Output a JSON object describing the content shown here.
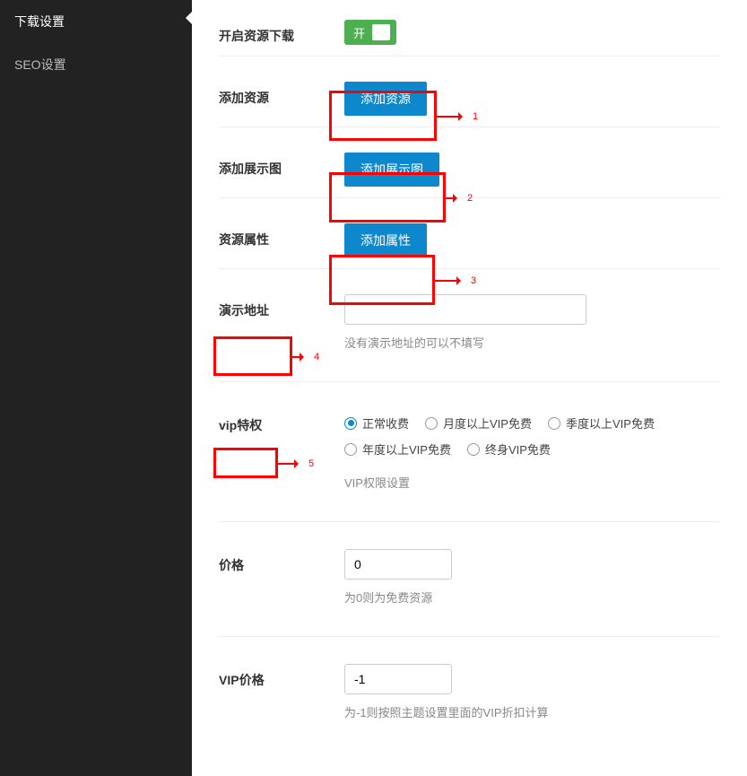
{
  "sidebar": {
    "items": [
      {
        "label": "下载设置",
        "active": true
      },
      {
        "label": "SEO设置",
        "active": false
      }
    ]
  },
  "settings": {
    "enable_download": {
      "label": "开启资源下载",
      "toggle_text": "开"
    },
    "add_resource": {
      "label": "添加资源",
      "button": "添加资源"
    },
    "add_showcase": {
      "label": "添加展示图",
      "button": "添加展示图"
    },
    "resource_attr": {
      "label": "资源属性",
      "button": "添加属性"
    },
    "demo_url": {
      "label": "演示地址",
      "value": "",
      "help": "没有演示地址的可以不填写"
    },
    "vip": {
      "label": "vip特权",
      "options": [
        "正常收费",
        "月度以上VIP免费",
        "季度以上VIP免费",
        "年度以上VIP免费",
        "终身VIP免费"
      ],
      "selected_index": 0,
      "help": "VIP权限设置"
    },
    "price": {
      "label": "价格",
      "value": "0",
      "help": "为0则为免费资源"
    },
    "vip_price": {
      "label": "VIP价格",
      "value": "-1",
      "help": "为-1则按照主题设置里面的VIP折扣计算"
    }
  },
  "annotations": {
    "n1": "1",
    "n2": "2",
    "n3": "3",
    "n4": "4",
    "n5": "5"
  }
}
